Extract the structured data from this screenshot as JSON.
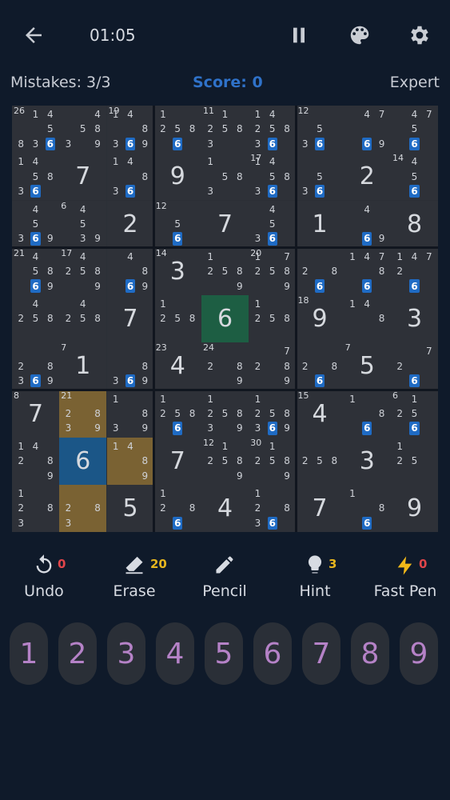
{
  "header": {
    "timer": "01:05",
    "back_icon": "arrow-left-icon",
    "pause_icon": "pause-icon",
    "theme_icon": "palette-icon",
    "settings_icon": "gear-icon"
  },
  "status": {
    "mistakes": "Mistakes: 3/3",
    "score": "Score: 0",
    "difficulty": "Expert"
  },
  "board": {
    "cells": [
      {
        "c": "26",
        "v": "",
        "n": [
          "",
          "1",
          "4",
          "",
          "",
          "5",
          "8",
          "3",
          "6",
          "9"
        ]
      },
      {
        "c": "",
        "v": "",
        "n": [
          "",
          "",
          "4",
          "",
          "5",
          "8",
          "3",
          "",
          "9"
        ]
      },
      {
        "c": "19",
        "v": "",
        "n": [
          "1",
          "4",
          "",
          "",
          "",
          "8",
          "3",
          "6",
          "9"
        ]
      },
      {
        "c": "",
        "v": "",
        "n": [
          "1",
          "",
          "",
          "2",
          "5",
          "8",
          "",
          "6",
          ""
        ]
      },
      {
        "c": "11",
        "v": "",
        "n": [
          "",
          "1",
          "",
          "2",
          "5",
          "8",
          "3",
          "",
          ""
        ]
      },
      {
        "c": "",
        "v": "",
        "n": [
          "1",
          "4",
          "",
          "2",
          "5",
          "8",
          "3",
          "6",
          ""
        ]
      },
      {
        "c": "12",
        "v": "",
        "n": [
          "",
          "",
          "",
          "",
          "5",
          "",
          "3",
          "6",
          ""
        ]
      },
      {
        "c": "",
        "v": "",
        "n": [
          "",
          "4",
          "7",
          "",
          "",
          "",
          "",
          "6",
          "9"
        ]
      },
      {
        "c": "",
        "v": "",
        "n": [
          "",
          "4",
          "7",
          "",
          "5",
          "",
          "",
          "6",
          ""
        ]
      },
      {
        "c": "",
        "v": "",
        "n": [
          "1",
          "4",
          "",
          "",
          "5",
          "8",
          "3",
          "6",
          ""
        ]
      },
      {
        "c": "",
        "v": "7",
        "n": []
      },
      {
        "c": "",
        "v": "",
        "n": [
          "1",
          "4",
          "",
          "",
          "",
          "8",
          "3",
          "6",
          ""
        ]
      },
      {
        "c": "",
        "v": "9",
        "n": []
      },
      {
        "c": "",
        "v": "",
        "n": [
          "1",
          "",
          "",
          "",
          "5",
          "8",
          "3",
          "",
          ""
        ]
      },
      {
        "c": "17",
        "v": "",
        "n": [
          "1",
          "4",
          "",
          "",
          "5",
          "8",
          "3",
          "6",
          ""
        ]
      },
      {
        "c": "",
        "v": "",
        "n": [
          "",
          "",
          "",
          "",
          "5",
          "",
          "3",
          "6",
          ""
        ]
      },
      {
        "c": "",
        "v": "2",
        "n": []
      },
      {
        "c": "14",
        "v": "",
        "n": [
          "",
          "4",
          "",
          "",
          "5",
          "",
          "",
          "6",
          ""
        ]
      },
      {
        "c": "",
        "v": "",
        "n": [
          "",
          "4",
          "",
          "",
          "5",
          "",
          "3",
          "6",
          "9"
        ]
      },
      {
        "c": "6",
        "v": "",
        "n": [
          "",
          "4",
          "",
          "",
          "5",
          "",
          "",
          "3",
          "9"
        ]
      },
      {
        "c": "",
        "v": "2",
        "n": []
      },
      {
        "c": "12",
        "v": "",
        "n": [
          "",
          "",
          "",
          "",
          "5",
          "",
          "",
          "6",
          ""
        ]
      },
      {
        "c": "",
        "v": "7",
        "n": []
      },
      {
        "c": "",
        "v": "",
        "n": [
          "",
          "4",
          "",
          "",
          "5",
          "",
          "3",
          "6",
          ""
        ]
      },
      {
        "c": "",
        "v": "1",
        "n": []
      },
      {
        "c": "",
        "v": "",
        "n": [
          "",
          "4",
          "",
          "",
          "",
          "",
          "",
          "6",
          "9"
        ]
      },
      {
        "c": "",
        "v": "8",
        "n": []
      },
      {
        "c": "21",
        "v": "",
        "n": [
          "",
          "4",
          "",
          "",
          "5",
          "8",
          "",
          "6",
          "9"
        ]
      },
      {
        "c": "17",
        "v": "",
        "n": [
          "",
          "4",
          "",
          "2",
          "5",
          "8",
          "",
          "",
          "9"
        ]
      },
      {
        "c": "",
        "v": "",
        "n": [
          "",
          "4",
          "",
          "",
          "",
          "8",
          "",
          "6",
          "9"
        ]
      },
      {
        "c": "14",
        "v": "3",
        "n": []
      },
      {
        "c": "",
        "v": "",
        "n": [
          "1",
          "",
          "",
          "2",
          "5",
          "8",
          "",
          "",
          "9"
        ]
      },
      {
        "c": "20",
        "v": "",
        "n": [
          "1",
          "",
          "7",
          "2",
          "5",
          "8",
          "",
          "",
          "9"
        ]
      },
      {
        "c": "",
        "v": "",
        "n": [
          "",
          "",
          "",
          "2",
          "",
          "8",
          "",
          "6",
          ""
        ]
      },
      {
        "c": "",
        "v": "",
        "n": [
          "1",
          "4",
          "7",
          "",
          "",
          "8",
          "",
          "6",
          ""
        ]
      },
      {
        "c": "",
        "v": "",
        "n": [
          "1",
          "4",
          "7",
          "2",
          "",
          "",
          "",
          "6",
          ""
        ]
      },
      {
        "c": "",
        "v": "",
        "n": [
          "",
          "4",
          "",
          "2",
          "5",
          "8",
          "",
          "",
          ""
        ]
      },
      {
        "c": "",
        "v": "",
        "n": [
          "",
          "4",
          "",
          "2",
          "5",
          "8",
          "",
          "",
          ""
        ]
      },
      {
        "c": "",
        "v": "7",
        "n": []
      },
      {
        "c": "",
        "v": "",
        "n": [
          "1",
          "",
          "",
          "2",
          "5",
          "8",
          "",
          "",
          ""
        ]
      },
      {
        "c": "",
        "v": "6",
        "n": []
      },
      {
        "c": "",
        "v": "",
        "n": [
          "1",
          "",
          "",
          "2",
          "5",
          "8",
          "",
          "",
          ""
        ]
      },
      {
        "c": "18",
        "v": "9",
        "n": []
      },
      {
        "c": "",
        "v": "",
        "n": [
          "1",
          "4",
          "",
          "",
          "",
          "8",
          "",
          "",
          ""
        ]
      },
      {
        "c": "",
        "v": "3",
        "n": []
      },
      {
        "c": "",
        "v": "",
        "n": [
          "",
          "",
          "",
          "2",
          "",
          "8",
          "3",
          "6",
          "9"
        ]
      },
      {
        "c": "7",
        "v": "1",
        "n": []
      },
      {
        "c": "",
        "v": "",
        "n": [
          "",
          "",
          "",
          "",
          "",
          "8",
          "3",
          "6",
          "9"
        ]
      },
      {
        "c": "23",
        "v": "4",
        "n": []
      },
      {
        "c": "24",
        "v": "",
        "n": [
          "",
          "",
          "",
          "2",
          "",
          "8",
          "",
          "",
          "9"
        ]
      },
      {
        "c": "",
        "v": "",
        "n": [
          "",
          "",
          "7",
          "2",
          "",
          "8",
          "",
          "",
          "9"
        ]
      },
      {
        "c": "",
        "v": "",
        "n": [
          "",
          "",
          "",
          "2",
          "",
          "8",
          "",
          "6",
          ""
        ]
      },
      {
        "c": "7",
        "v": "5",
        "n": []
      },
      {
        "c": "",
        "v": "",
        "n": [
          "",
          "",
          "7",
          "2",
          "",
          "",
          "",
          "6",
          ""
        ]
      },
      {
        "c": "8",
        "v": "7",
        "n": []
      },
      {
        "c": "21",
        "v": "",
        "n": [
          "",
          "",
          "",
          "2",
          "",
          "8",
          "3",
          "",
          "9"
        ]
      },
      {
        "c": "",
        "v": "",
        "n": [
          "1",
          "",
          "",
          "",
          "",
          "8",
          "3",
          "",
          "9"
        ]
      },
      {
        "c": "",
        "v": "",
        "n": [
          "1",
          "",
          "",
          "2",
          "5",
          "8",
          "",
          "6",
          ""
        ]
      },
      {
        "c": "",
        "v": "",
        "n": [
          "1",
          "",
          "",
          "2",
          "5",
          "8",
          "3",
          "",
          "9"
        ]
      },
      {
        "c": "",
        "v": "",
        "n": [
          "1",
          "",
          "",
          "2",
          "5",
          "8",
          "3",
          "6",
          "9"
        ]
      },
      {
        "c": "15",
        "v": "4",
        "n": []
      },
      {
        "c": "",
        "v": "",
        "n": [
          "1",
          "",
          "",
          "",
          "",
          "8",
          "",
          "6",
          ""
        ]
      },
      {
        "c": "6",
        "v": "",
        "n": [
          "",
          "1",
          "",
          "2",
          "5",
          "",
          "",
          "6",
          ""
        ]
      },
      {
        "c": "",
        "v": "",
        "n": [
          "1",
          "4",
          "",
          "2",
          "",
          "8",
          "",
          "",
          "9"
        ]
      },
      {
        "c": "",
        "v": "6",
        "n": []
      },
      {
        "c": "",
        "v": "",
        "n": [
          "1",
          "4",
          "",
          "",
          "",
          "8",
          "",
          "",
          "9"
        ]
      },
      {
        "c": "",
        "v": "7",
        "n": []
      },
      {
        "c": "12",
        "v": "",
        "n": [
          "",
          "1",
          "",
          "2",
          "5",
          "8",
          "",
          "",
          "9"
        ]
      },
      {
        "c": "30",
        "v": "",
        "n": [
          "",
          "1",
          "",
          "2",
          "5",
          "8",
          "",
          "",
          "9"
        ]
      },
      {
        "c": "",
        "v": "",
        "n": [
          "",
          "",
          "",
          "2",
          "5",
          "8",
          "",
          "",
          ""
        ]
      },
      {
        "c": "",
        "v": "3",
        "n": []
      },
      {
        "c": "",
        "v": "",
        "n": [
          "1",
          "",
          "",
          "2",
          "5",
          "",
          "",
          "",
          ""
        ]
      },
      {
        "c": "",
        "v": "",
        "n": [
          "1",
          "",
          "",
          "2",
          "",
          "8",
          "3",
          "",
          ""
        ]
      },
      {
        "c": "",
        "v": "",
        "n": [
          "",
          "",
          "",
          "2",
          "",
          "8",
          "3",
          "",
          ""
        ]
      },
      {
        "c": "",
        "v": "5",
        "n": []
      },
      {
        "c": "",
        "v": "",
        "n": [
          "1",
          "",
          "",
          "2",
          "",
          "8",
          "",
          "6",
          ""
        ]
      },
      {
        "c": "",
        "v": "4",
        "n": []
      },
      {
        "c": "",
        "v": "",
        "n": [
          "1",
          "",
          "",
          "2",
          "",
          "8",
          "3",
          "6",
          ""
        ]
      },
      {
        "c": "",
        "v": "7",
        "n": []
      },
      {
        "c": "",
        "v": "",
        "n": [
          "1",
          "",
          "",
          "",
          "",
          "8",
          "",
          "6",
          ""
        ]
      },
      {
        "c": "",
        "v": "9",
        "n": []
      }
    ],
    "highlight": {
      "green": [
        40
      ],
      "blue": [
        64
      ],
      "amber": [
        55,
        65,
        73
      ]
    }
  },
  "tools": [
    {
      "label": "Undo",
      "icon": "undo-icon",
      "count": "0",
      "count_color": "#e0454a"
    },
    {
      "label": "Erase",
      "icon": "eraser-icon",
      "count": "20",
      "count_color": "#e6b51e"
    },
    {
      "label": "Pencil",
      "icon": "pencil-icon",
      "count": "",
      "count_color": "#e6b51e"
    },
    {
      "label": "Hint",
      "icon": "lightbulb-icon",
      "count": "3",
      "count_color": "#e6b51e"
    },
    {
      "label": "Fast Pen",
      "icon": "lightning-icon",
      "count": "0",
      "count_color": "#e0454a"
    }
  ],
  "numpad": [
    "1",
    "2",
    "3",
    "4",
    "5",
    "6",
    "7",
    "8",
    "9"
  ]
}
